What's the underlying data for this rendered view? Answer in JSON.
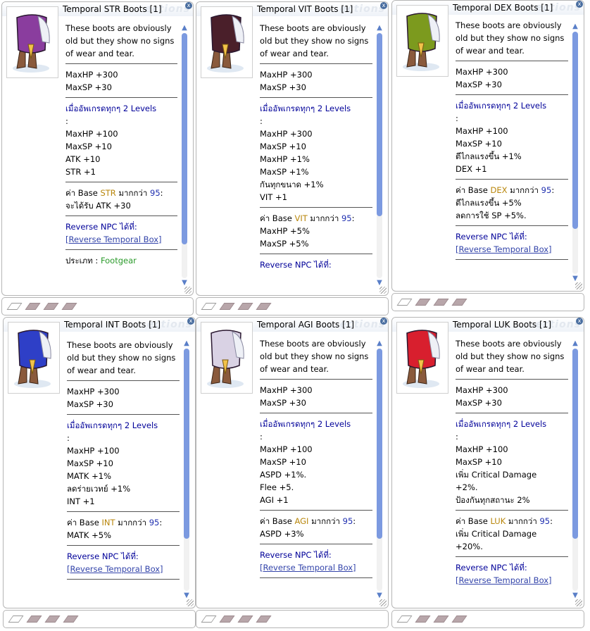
{
  "tooltips": [
    {
      "title": "Temporal STR Boots [1]",
      "icon": "purple-boots-icon",
      "color": "#8a3d9e",
      "lines": [
        [
          {
            "t": "These boots are obviously"
          }
        ],
        [
          {
            "t": "old but they show no signs"
          }
        ],
        [
          {
            "t": "of wear and tear."
          }
        ],
        "sep",
        [
          {
            "t": "MaxHP +300"
          }
        ],
        [
          {
            "t": "MaxSP +30"
          }
        ],
        "sep",
        [
          {
            "t": "เมื่ออัพเกรดทุกๆ 2 Levels",
            "c": "blue"
          }
        ],
        [
          {
            "t": ":"
          }
        ],
        [
          {
            "t": "MaxHP +100"
          }
        ],
        [
          {
            "t": "MaxSP +10"
          }
        ],
        [
          {
            "t": "ATK +10"
          }
        ],
        [
          {
            "t": "STR +1"
          }
        ],
        "sep",
        [
          {
            "t": "ค่า Base "
          },
          {
            "t": "STR",
            "c": "orange"
          },
          {
            "t": " มากกว่า "
          },
          {
            "t": "95",
            "c": "numb"
          },
          {
            "t": ":"
          }
        ],
        [
          {
            "t": "จะได้รับ ATK +30"
          }
        ],
        "sep",
        [
          {
            "t": "Reverse NPC ได้ที่:",
            "c": "blue"
          }
        ],
        [
          {
            "t": "[Reverse Temporal Box]",
            "c": "link"
          }
        ],
        "sep",
        [
          {
            "t": "ประเภท : "
          },
          {
            "t": "Footgear",
            "c": "green"
          }
        ]
      ]
    },
    {
      "title": "Temporal VIT Boots [1]",
      "icon": "dark-red-boots-icon",
      "color": "#4a1f2a",
      "lines": [
        [
          {
            "t": "These boots are obviously"
          }
        ],
        [
          {
            "t": "old but they show no signs"
          }
        ],
        [
          {
            "t": "of wear and tear."
          }
        ],
        "sep",
        [
          {
            "t": "MaxHP +300"
          }
        ],
        [
          {
            "t": "MaxSP +30"
          }
        ],
        "sep",
        [
          {
            "t": "เมื่ออัพเกรดทุกๆ 2 Levels",
            "c": "blue"
          }
        ],
        [
          {
            "t": ":"
          }
        ],
        [
          {
            "t": "MaxHP +300"
          }
        ],
        [
          {
            "t": "MaxSP +10"
          }
        ],
        [
          {
            "t": "MaxHP +1%"
          }
        ],
        [
          {
            "t": "MaxSP +1%"
          }
        ],
        [
          {
            "t": "กันทุกขนาด +1%"
          }
        ],
        [
          {
            "t": "VIT +1"
          }
        ],
        "sep",
        [
          {
            "t": "ค่า Base "
          },
          {
            "t": "VIT",
            "c": "orange"
          },
          {
            "t": " มากกว่า "
          },
          {
            "t": "95",
            "c": "numb"
          },
          {
            "t": ":"
          }
        ],
        [
          {
            "t": "MaxHP +5%"
          }
        ],
        [
          {
            "t": "MaxSP +5%"
          }
        ],
        "sep",
        [
          {
            "t": "Reverse NPC ได้ที่:",
            "c": "blue"
          }
        ]
      ]
    },
    {
      "title": "Temporal DEX Boots [1]",
      "icon": "green-boots-icon",
      "color": "#7c9a1e",
      "lines": [
        [
          {
            "t": "These boots are obviously"
          }
        ],
        [
          {
            "t": "old but they show no signs"
          }
        ],
        [
          {
            "t": "of wear and tear."
          }
        ],
        "sep",
        [
          {
            "t": "MaxHP +300"
          }
        ],
        [
          {
            "t": "MaxSP +30"
          }
        ],
        "sep",
        [
          {
            "t": "เมื่ออัพเกรดทุกๆ 2 Levels",
            "c": "blue"
          }
        ],
        [
          {
            "t": ":"
          }
        ],
        [
          {
            "t": "MaxHP +100"
          }
        ],
        [
          {
            "t": "MaxSP +10"
          }
        ],
        [
          {
            "t": "ตีไกลแรงขึ้น +1%"
          }
        ],
        [
          {
            "t": "DEX +1"
          }
        ],
        "sep",
        [
          {
            "t": "ค่า Base "
          },
          {
            "t": "DEX",
            "c": "orange"
          },
          {
            "t": " มากกว่า "
          },
          {
            "t": "95",
            "c": "numb"
          },
          {
            "t": ":"
          }
        ],
        [
          {
            "t": "ตีไกลแรงขึ้น +5%"
          }
        ],
        [
          {
            "t": "ลดการใช้ SP +5%."
          }
        ],
        "sep",
        [
          {
            "t": "Reverse NPC ได้ที่:",
            "c": "blue"
          }
        ],
        [
          {
            "t": "[Reverse Temporal Box]",
            "c": "link"
          }
        ],
        "sep"
      ]
    },
    {
      "title": "Temporal INT Boots [1]",
      "icon": "blue-boots-icon",
      "color": "#2e3fc7",
      "lines": [
        [
          {
            "t": "These boots are obviously"
          }
        ],
        [
          {
            "t": "old but they show no signs"
          }
        ],
        [
          {
            "t": "of wear and tear."
          }
        ],
        "sep",
        [
          {
            "t": "MaxHP +300"
          }
        ],
        [
          {
            "t": "MaxSP +30"
          }
        ],
        "sep",
        [
          {
            "t": "เมื่ออัพเกรดทุกๆ 2 Levels",
            "c": "blue"
          }
        ],
        [
          {
            "t": ":"
          }
        ],
        [
          {
            "t": "MaxHP +100"
          }
        ],
        [
          {
            "t": "MaxSP +10"
          }
        ],
        [
          {
            "t": "MATK +1%"
          }
        ],
        [
          {
            "t": "ลดร่ายเวทย์ +1%"
          }
        ],
        [
          {
            "t": "INT +1"
          }
        ],
        "sep",
        [
          {
            "t": "ค่า Base "
          },
          {
            "t": "INT",
            "c": "orange"
          },
          {
            "t": " มากกว่า "
          },
          {
            "t": "95",
            "c": "numb"
          },
          {
            "t": ":"
          }
        ],
        [
          {
            "t": "MATK +5%"
          }
        ],
        "sep",
        [
          {
            "t": "Reverse NPC ได้ที่:",
            "c": "blue"
          }
        ],
        [
          {
            "t": "[Reverse Temporal Box]",
            "c": "link"
          }
        ],
        "sep"
      ]
    },
    {
      "title": "Temporal AGI Boots [1]",
      "icon": "white-red-boots-icon",
      "color": "#d9d2e4",
      "lines": [
        [
          {
            "t": "These boots are obviously"
          }
        ],
        [
          {
            "t": "old but they show no signs"
          }
        ],
        [
          {
            "t": "of wear and tear."
          }
        ],
        "sep",
        [
          {
            "t": "MaxHP +300"
          }
        ],
        [
          {
            "t": "MaxSP +30"
          }
        ],
        "sep",
        [
          {
            "t": "เมื่ออัพเกรดทุกๆ 2 Levels",
            "c": "blue"
          }
        ],
        [
          {
            "t": ":"
          }
        ],
        [
          {
            "t": "MaxHP +100"
          }
        ],
        [
          {
            "t": "MaxSP +10"
          }
        ],
        [
          {
            "t": "ASPD +1%."
          }
        ],
        [
          {
            "t": "Flee +5."
          }
        ],
        [
          {
            "t": "AGI +1"
          }
        ],
        "sep",
        [
          {
            "t": "ค่า Base "
          },
          {
            "t": "AGI",
            "c": "orange"
          },
          {
            "t": " มากกว่า "
          },
          {
            "t": "95",
            "c": "numb"
          },
          {
            "t": ":"
          }
        ],
        [
          {
            "t": "ASPD +3%"
          }
        ],
        "sep",
        [
          {
            "t": "Reverse NPC ได้ที่:",
            "c": "blue"
          }
        ],
        [
          {
            "t": "[Reverse Temporal Box]",
            "c": "link"
          }
        ],
        "sep"
      ]
    },
    {
      "title": "Temporal LUK Boots [1]",
      "icon": "red-boots-icon",
      "color": "#d81f2e",
      "lines": [
        [
          {
            "t": "These boots are obviously"
          }
        ],
        [
          {
            "t": "old but they show no signs"
          }
        ],
        [
          {
            "t": "of wear and tear."
          }
        ],
        "sep",
        [
          {
            "t": "MaxHP +300"
          }
        ],
        [
          {
            "t": "MaxSP +30"
          }
        ],
        "sep",
        [
          {
            "t": "เมื่ออัพเกรดทุกๆ 2 Levels",
            "c": "blue"
          }
        ],
        [
          {
            "t": ":"
          }
        ],
        [
          {
            "t": "MaxHP +100"
          }
        ],
        [
          {
            "t": "MaxSP +10"
          }
        ],
        [
          {
            "t": "เพิ่ม Critical Damage"
          }
        ],
        [
          {
            "t": "+2%."
          }
        ],
        [
          {
            "t": "ป้องกันทุกสถานะ 2%"
          }
        ],
        "sep",
        [
          {
            "t": "ค่า Base "
          },
          {
            "t": "LUK",
            "c": "orange"
          },
          {
            "t": " มากกว่า "
          },
          {
            "t": "95",
            "c": "numb"
          },
          {
            "t": ":"
          }
        ],
        [
          {
            "t": "เพิ่ม Critical Damage"
          }
        ],
        [
          {
            "t": "+20%."
          }
        ],
        "sep",
        [
          {
            "t": "Reverse NPC ได้ที่:",
            "c": "blue"
          }
        ],
        [
          {
            "t": "[Reverse Temporal Box]",
            "c": "link"
          }
        ]
      ]
    }
  ],
  "ghost_text": "ections",
  "close_glyph": "x",
  "scroll_up": "▲",
  "scroll_down": "▼"
}
